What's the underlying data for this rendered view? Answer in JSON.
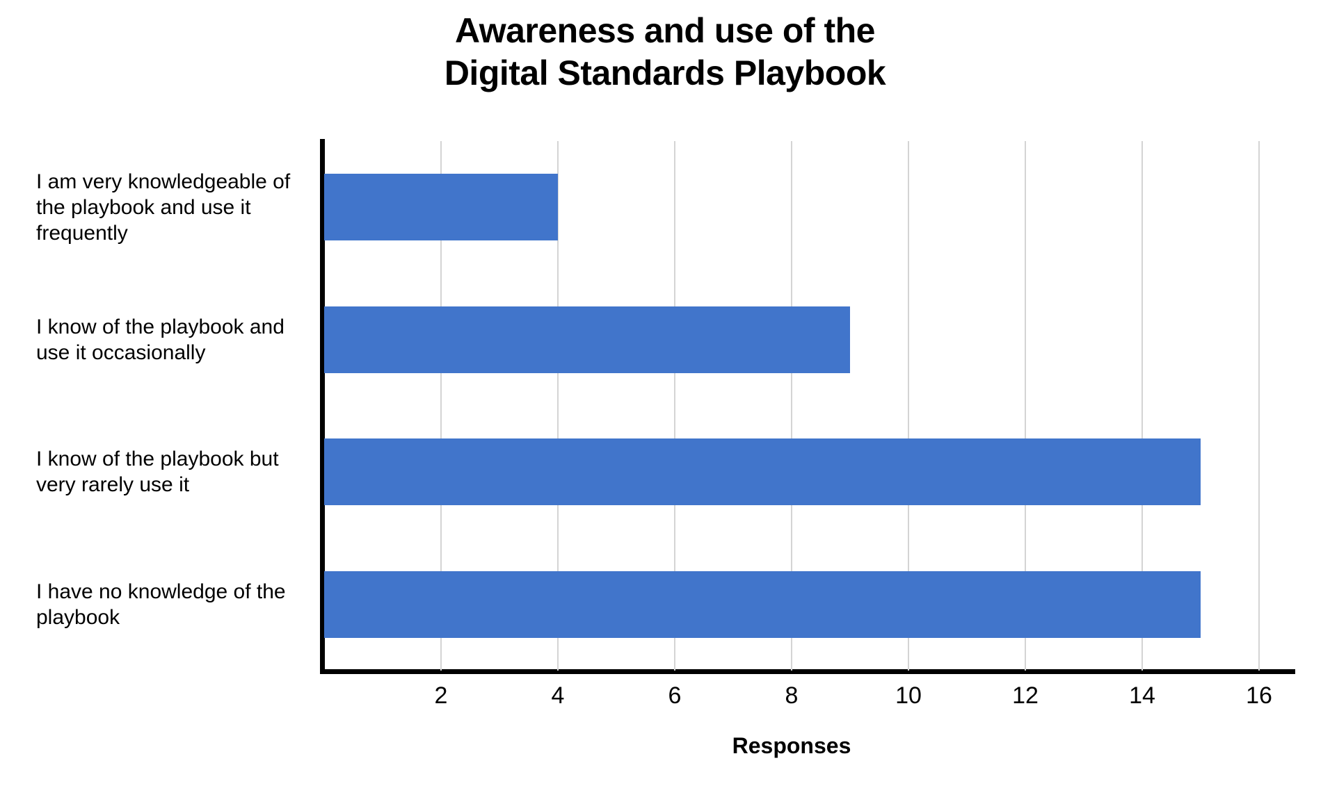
{
  "chart_data": {
    "type": "bar",
    "orientation": "horizontal",
    "title": "Awareness and use of the\nDigital Standards Playbook",
    "categories": [
      "I am very knowledgeable of the playbook and use it frequently",
      "I know of the playbook and use it occasionally",
      "I know of the playbook but very rarely use it",
      "I have no knowledge of the playbook"
    ],
    "values": [
      4,
      9,
      15,
      15
    ],
    "xlabel": "Responses",
    "ylabel": "",
    "xlim": [
      0,
      16
    ],
    "xticks": [
      2,
      4,
      6,
      8,
      10,
      12,
      14,
      16
    ],
    "xtick_labels": [
      "2",
      "4",
      "6",
      "8",
      "10",
      "12",
      "14",
      "16"
    ],
    "grid": "vertical",
    "legend": "none",
    "bar_color": "#4175cb",
    "gridline_color": "#d4d4d4",
    "axis_color": "#000000",
    "background_color": "#ffffff"
  }
}
